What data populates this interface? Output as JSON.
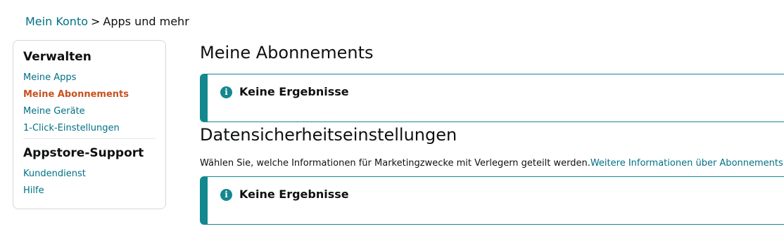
{
  "breadcrumb": {
    "parent": "Mein Konto",
    "separator": ">",
    "current": "Apps und mehr"
  },
  "sidebar": {
    "manage_heading": "Verwalten",
    "manage_items": [
      {
        "label": "Meine Apps",
        "active": false
      },
      {
        "label": "Meine Abonnements",
        "active": true
      },
      {
        "label": "Meine Geräte",
        "active": false
      },
      {
        "label": "1-Click-Einstellungen",
        "active": false
      }
    ],
    "support_heading": "Appstore-Support",
    "support_items": [
      {
        "label": "Kundendienst"
      },
      {
        "label": "Hilfe"
      }
    ]
  },
  "main": {
    "subscriptions": {
      "title": "Meine Abonnements",
      "alert_icon": "info-icon",
      "alert_text": "Keine Ergebnisse"
    },
    "privacy": {
      "title": "Datensicherheitseinstellungen",
      "description": "Wählen Sie, welche Informationen für Marketingzwecke mit Verlegern geteilt werden.",
      "link": "Weitere Informationen über Abonnements",
      "alert_icon": "info-icon",
      "alert_text": "Keine Ergebnisse"
    }
  },
  "colors": {
    "link": "#007185",
    "active": "#c7511f",
    "alert_accent": "#13888f"
  }
}
